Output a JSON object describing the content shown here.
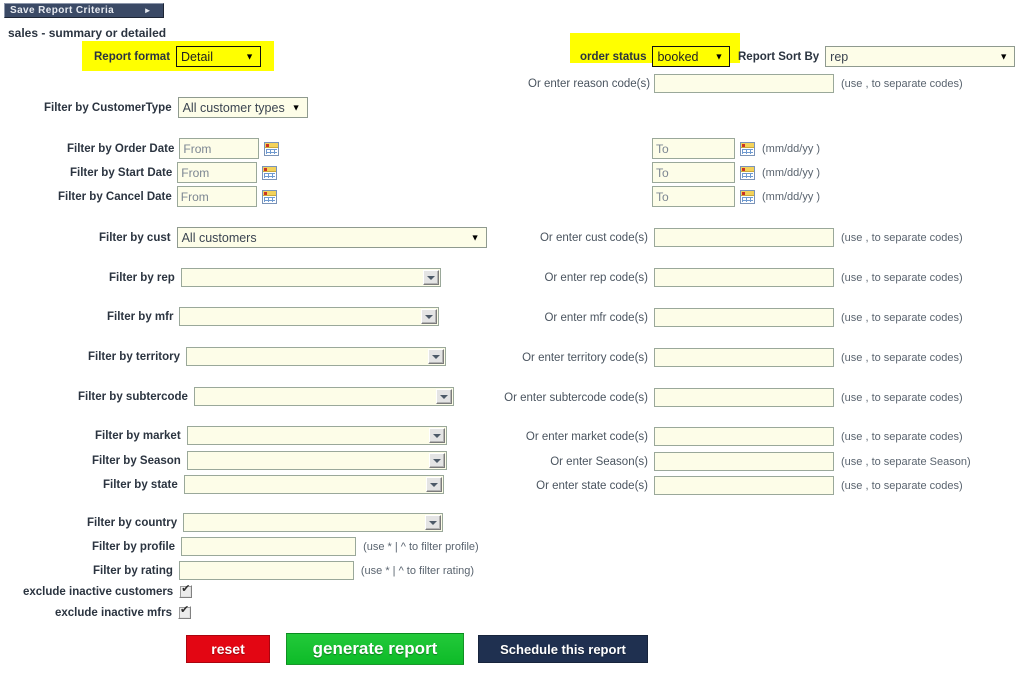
{
  "header": {
    "save_tab_label": "Save Report Criteria",
    "save_tab_arrow": "►",
    "page_title": "sales - summary or detailed"
  },
  "top": {
    "report_format_label": "Report format",
    "report_format_value": "Detail",
    "order_status_label": "order status",
    "order_status_value": "booked",
    "report_sort_label": "Report Sort By",
    "report_sort_value": "rep",
    "reason_code_label": "Or enter reason code(s)",
    "reason_code_value": "",
    "reason_code_hint": "(use , to separate codes)",
    "customer_type_label": "Filter by CustomerType",
    "customer_type_value": "All customer types"
  },
  "dates": [
    {
      "label": "Filter by Order Date",
      "from_placeholder": "From",
      "to_placeholder": "To",
      "format_hint": "(mm/dd/yy )"
    },
    {
      "label": "Filter by Start Date",
      "from_placeholder": "From",
      "to_placeholder": "To",
      "format_hint": "(mm/dd/yy )"
    },
    {
      "label": "Filter by Cancel Date",
      "from_placeholder": "From",
      "to_placeholder": "To",
      "format_hint": "(mm/dd/yy )"
    }
  ],
  "filters": {
    "cust": {
      "label": "Filter by cust",
      "value": "All customers",
      "code_label": "Or enter cust code(s)",
      "code_value": "",
      "code_hint": "(use , to separate codes)"
    },
    "rep": {
      "label": "Filter by rep",
      "value": "",
      "code_label": "Or enter rep code(s)",
      "code_value": "",
      "code_hint": "(use , to separate codes)"
    },
    "mfr": {
      "label": "Filter by mfr",
      "value": "",
      "code_label": "Or enter mfr code(s)",
      "code_value": "",
      "code_hint": "(use , to separate codes)"
    },
    "territory": {
      "label": "Filter by territory",
      "value": "",
      "code_label": "Or enter territory code(s)",
      "code_value": "",
      "code_hint": "(use , to separate codes)"
    },
    "subtercode": {
      "label": "Filter by subtercode",
      "value": "",
      "code_label": "Or enter subtercode code(s)",
      "code_value": "",
      "code_hint": "(use , to separate codes)"
    },
    "market": {
      "label": "Filter by market",
      "value": "",
      "code_label": "Or enter market code(s)",
      "code_value": "",
      "code_hint": "(use , to separate codes)"
    },
    "season": {
      "label": "Filter by Season",
      "value": "",
      "code_label": "Or enter Season(s)",
      "code_value": "",
      "code_hint": "(use , to separate Season)"
    },
    "state": {
      "label": "Filter by state",
      "value": "",
      "code_label": "Or enter state code(s)",
      "code_value": "",
      "code_hint": "(use , to separate codes)"
    },
    "country": {
      "label": "Filter by country",
      "value": ""
    },
    "profile": {
      "label": "Filter by profile",
      "value": "",
      "hint": "(use * | ^ to filter profile)"
    },
    "rating": {
      "label": "Filter by rating",
      "value": "",
      "hint": "(use * | ^ to filter rating)"
    }
  },
  "checkboxes": [
    {
      "label": "exclude inactive customers",
      "checked": true
    },
    {
      "label": "exclude inactive mfrs",
      "checked": true
    }
  ],
  "buttons": {
    "reset": "reset",
    "generate": "generate report",
    "schedule": "Schedule this report"
  },
  "colors": {
    "highlight": "#ffff00",
    "tab_bg": "#3b4a66",
    "reset_bg": "#e30613",
    "generate_bg": "#0dbb28",
    "schedule_bg": "#1f3050",
    "field_bg": "#fdfde8"
  }
}
